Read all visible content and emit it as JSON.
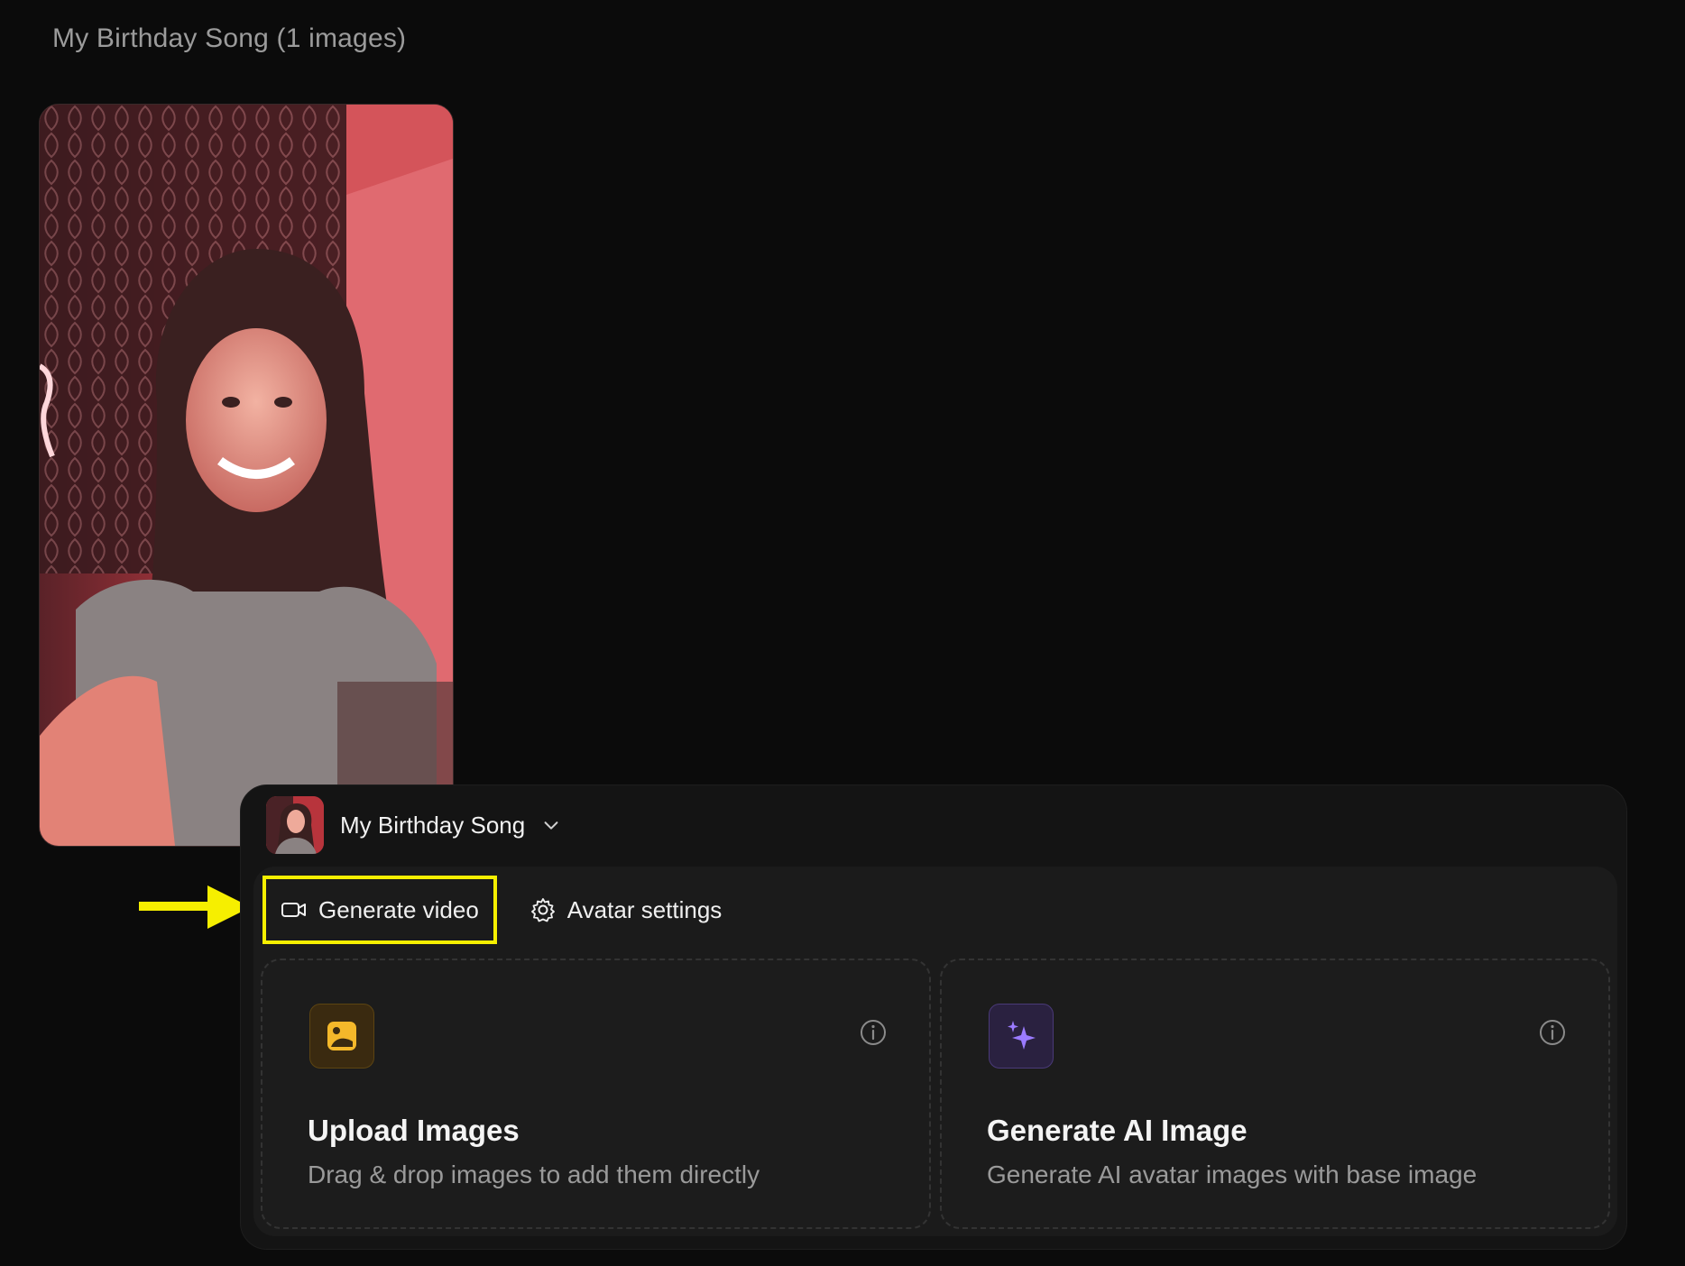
{
  "page": {
    "title": "My Birthday Song (1 images)"
  },
  "photo": {
    "alt": "Avatar photo"
  },
  "panel": {
    "avatar_name": "My Birthday Song",
    "tabs": [
      {
        "label": "Generate video",
        "icon": "video-camera-icon",
        "highlighted": true
      },
      {
        "label": "Avatar settings",
        "icon": "gear-icon",
        "highlighted": false
      }
    ],
    "cards": [
      {
        "title": "Upload Images",
        "description": "Drag & drop images to add them directly",
        "icon": "image-upload-icon",
        "accent": "#f4b82a"
      },
      {
        "title": "Generate AI Image",
        "description": "Generate AI avatar images with base image",
        "icon": "sparkle-icon",
        "accent": "#9b7bff"
      }
    ]
  },
  "annotation": {
    "highlight_color": "#f6ef00"
  }
}
